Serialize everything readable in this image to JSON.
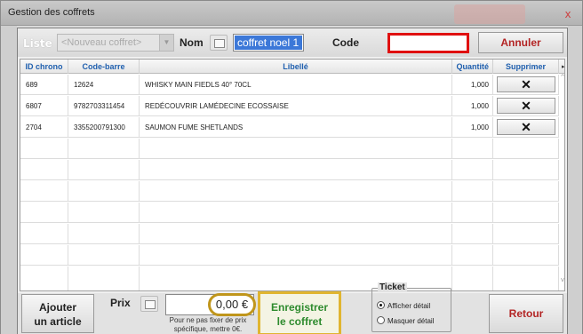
{
  "window": {
    "title": "Gestion des coffrets",
    "close_glyph": "x"
  },
  "toolbar": {
    "liste_label": "Liste",
    "liste_value": "<Nouveau coffret>",
    "nom_label": "Nom",
    "nom_value": "coffret noel 1",
    "code_label": "Code",
    "code_value": "",
    "annuler_label": "Annuler"
  },
  "table": {
    "headers": [
      "ID chrono",
      "Code-barre",
      "Libellé",
      "Quantité",
      "Supprimer"
    ],
    "rows": [
      {
        "id": "689",
        "barcode": "12624",
        "label": "WHISKY MAIN FIEDLS 40° 70CL",
        "qty": "1,000"
      },
      {
        "id": "6807",
        "barcode": "9782703311454",
        "label": "REDÉCOUVRIR LAMÉDECINE ECOSSAISE",
        "qty": "1,000"
      },
      {
        "id": "2704",
        "barcode": "3355200791300",
        "label": "SAUMON FUME SHETLANDS",
        "qty": "1,000"
      }
    ],
    "delete_glyph": "✕"
  },
  "footer": {
    "ajouter_line1": "Ajouter",
    "ajouter_line2": "un article",
    "prix_label": "Prix",
    "prix_value": "0,00 €",
    "prix_hint": "Pour ne pas fixer de prix spécifique, mettre 0€.",
    "enregistrer_line1": "Enregistrer",
    "enregistrer_line2": "le coffret",
    "ticket_legend": "Ticket",
    "ticket_options": [
      {
        "label": "Afficher détail",
        "selected": true
      },
      {
        "label": "Masquer détail",
        "selected": false
      }
    ],
    "retour_label": "Retour"
  },
  "colors": {
    "accent_red": "#e01010",
    "highlight_gold": "#c0961c",
    "header_blue": "#1f5fae",
    "save_green": "#2e8b2e"
  }
}
